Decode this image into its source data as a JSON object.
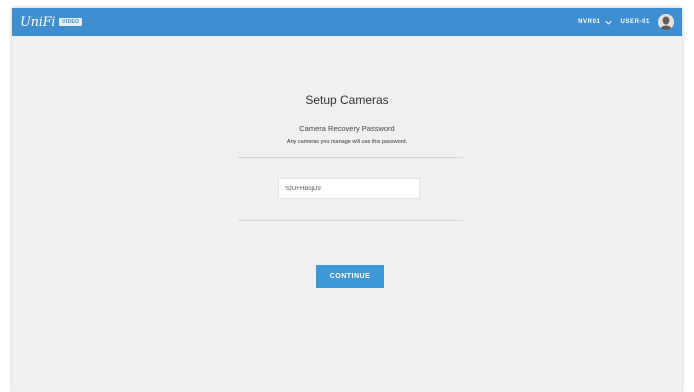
{
  "header": {
    "logo_text": "UniFi",
    "badge": "VIDEO",
    "nvr_label": "NVR01",
    "user_label": "USER-01"
  },
  "setup": {
    "title": "Setup Cameras",
    "subtitle": "Camera Recovery Password",
    "hint": "Any cameras you manage will use this password.",
    "password_value": "SzUFHBojD9",
    "continue_label": "CONTINUE"
  },
  "colors": {
    "topbar": "#3e8ed0",
    "button": "#3e98d8",
    "background": "#f0f0f0"
  },
  "icons": {
    "nvr_dropdown": "chevron-down-icon",
    "user_avatar": "avatar"
  }
}
